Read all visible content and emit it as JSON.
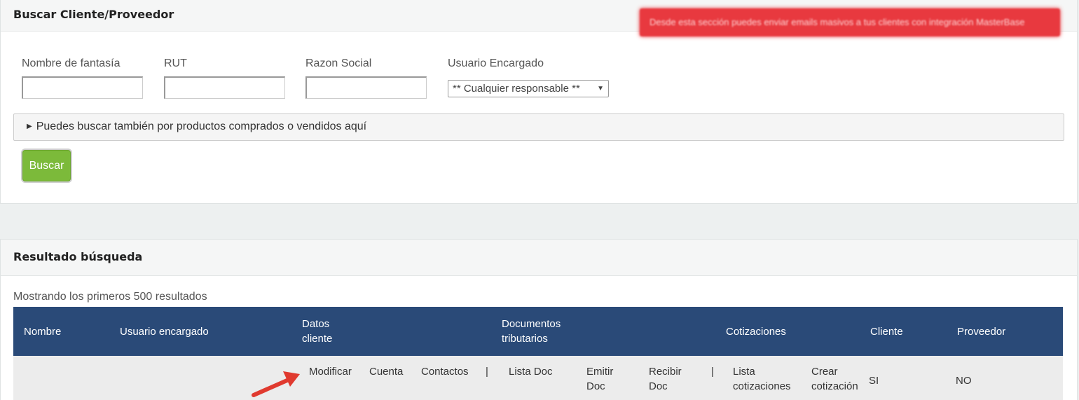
{
  "search_panel": {
    "title": "Buscar Cliente/Proveedor",
    "alert_text": "Desde esta sección puedes enviar emails masivos a tus clientes con integración MasterBase",
    "fields": [
      {
        "label": "Nombre de fantasía",
        "value": ""
      },
      {
        "label": "RUT",
        "value": ""
      },
      {
        "label": "Razon Social",
        "value": ""
      }
    ],
    "owner": {
      "label": "Usuario Encargado",
      "selected": "** Cualquier responsable **"
    },
    "products_toggle": "Puedes buscar también por productos comprados o vendidos aquí",
    "search_button": "Buscar",
    "colors": {
      "button": "#7cba3a",
      "alert": "#e8393f",
      "table_header": "#2a4a78"
    }
  },
  "result_panel": {
    "title": "Resultado búsqueda",
    "info": "Mostrando los primeros 500 resultados",
    "columns": {
      "nombre": "Nombre",
      "usuario": "Usuario encargado",
      "datos_1": "Datos",
      "datos_2": "cliente",
      "docs_1": "Documentos",
      "docs_2": "tributarios",
      "cotizaciones": "Cotizaciones",
      "cliente": "Cliente",
      "proveedor": "Proveedor"
    },
    "row": {
      "nombre": "",
      "usuario": "",
      "modificar": "Modificar",
      "cuenta": "Cuenta",
      "contactos": "Contactos",
      "sep": "|",
      "lista_doc": "Lista Doc",
      "emitir_1": "Emitir",
      "emitir_2": "Doc",
      "recibir_1": "Recibir",
      "recibir_2": "Doc",
      "lista_cot_1": "Lista",
      "lista_cot_2": "cotizaciones",
      "crear_1": "Crear",
      "crear_2": "cotización",
      "cliente": "SI",
      "proveedor": "NO"
    }
  }
}
